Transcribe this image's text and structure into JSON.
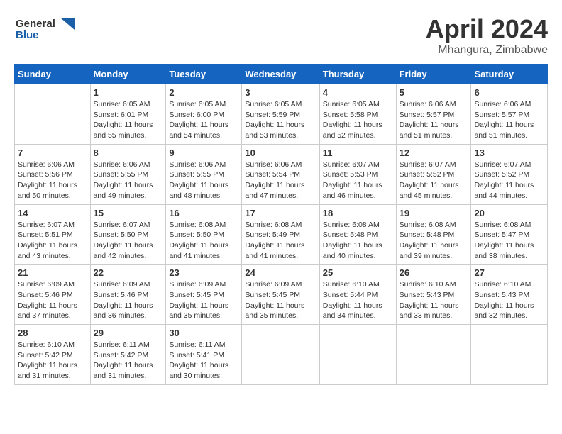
{
  "header": {
    "logo_general": "General",
    "logo_blue": "Blue",
    "title": "April 2024",
    "subtitle": "Mhangura, Zimbabwe"
  },
  "columns": [
    "Sunday",
    "Monday",
    "Tuesday",
    "Wednesday",
    "Thursday",
    "Friday",
    "Saturday"
  ],
  "weeks": [
    [
      {
        "day": "",
        "info": ""
      },
      {
        "day": "1",
        "info": "Sunrise: 6:05 AM\nSunset: 6:01 PM\nDaylight: 11 hours and 55 minutes."
      },
      {
        "day": "2",
        "info": "Sunrise: 6:05 AM\nSunset: 6:00 PM\nDaylight: 11 hours and 54 minutes."
      },
      {
        "day": "3",
        "info": "Sunrise: 6:05 AM\nSunset: 5:59 PM\nDaylight: 11 hours and 53 minutes."
      },
      {
        "day": "4",
        "info": "Sunrise: 6:05 AM\nSunset: 5:58 PM\nDaylight: 11 hours and 52 minutes."
      },
      {
        "day": "5",
        "info": "Sunrise: 6:06 AM\nSunset: 5:57 PM\nDaylight: 11 hours and 51 minutes."
      },
      {
        "day": "6",
        "info": "Sunrise: 6:06 AM\nSunset: 5:57 PM\nDaylight: 11 hours and 51 minutes."
      }
    ],
    [
      {
        "day": "7",
        "info": "Sunrise: 6:06 AM\nSunset: 5:56 PM\nDaylight: 11 hours and 50 minutes."
      },
      {
        "day": "8",
        "info": "Sunrise: 6:06 AM\nSunset: 5:55 PM\nDaylight: 11 hours and 49 minutes."
      },
      {
        "day": "9",
        "info": "Sunrise: 6:06 AM\nSunset: 5:55 PM\nDaylight: 11 hours and 48 minutes."
      },
      {
        "day": "10",
        "info": "Sunrise: 6:06 AM\nSunset: 5:54 PM\nDaylight: 11 hours and 47 minutes."
      },
      {
        "day": "11",
        "info": "Sunrise: 6:07 AM\nSunset: 5:53 PM\nDaylight: 11 hours and 46 minutes."
      },
      {
        "day": "12",
        "info": "Sunrise: 6:07 AM\nSunset: 5:52 PM\nDaylight: 11 hours and 45 minutes."
      },
      {
        "day": "13",
        "info": "Sunrise: 6:07 AM\nSunset: 5:52 PM\nDaylight: 11 hours and 44 minutes."
      }
    ],
    [
      {
        "day": "14",
        "info": "Sunrise: 6:07 AM\nSunset: 5:51 PM\nDaylight: 11 hours and 43 minutes."
      },
      {
        "day": "15",
        "info": "Sunrise: 6:07 AM\nSunset: 5:50 PM\nDaylight: 11 hours and 42 minutes."
      },
      {
        "day": "16",
        "info": "Sunrise: 6:08 AM\nSunset: 5:50 PM\nDaylight: 11 hours and 41 minutes."
      },
      {
        "day": "17",
        "info": "Sunrise: 6:08 AM\nSunset: 5:49 PM\nDaylight: 11 hours and 41 minutes."
      },
      {
        "day": "18",
        "info": "Sunrise: 6:08 AM\nSunset: 5:48 PM\nDaylight: 11 hours and 40 minutes."
      },
      {
        "day": "19",
        "info": "Sunrise: 6:08 AM\nSunset: 5:48 PM\nDaylight: 11 hours and 39 minutes."
      },
      {
        "day": "20",
        "info": "Sunrise: 6:08 AM\nSunset: 5:47 PM\nDaylight: 11 hours and 38 minutes."
      }
    ],
    [
      {
        "day": "21",
        "info": "Sunrise: 6:09 AM\nSunset: 5:46 PM\nDaylight: 11 hours and 37 minutes."
      },
      {
        "day": "22",
        "info": "Sunrise: 6:09 AM\nSunset: 5:46 PM\nDaylight: 11 hours and 36 minutes."
      },
      {
        "day": "23",
        "info": "Sunrise: 6:09 AM\nSunset: 5:45 PM\nDaylight: 11 hours and 35 minutes."
      },
      {
        "day": "24",
        "info": "Sunrise: 6:09 AM\nSunset: 5:45 PM\nDaylight: 11 hours and 35 minutes."
      },
      {
        "day": "25",
        "info": "Sunrise: 6:10 AM\nSunset: 5:44 PM\nDaylight: 11 hours and 34 minutes."
      },
      {
        "day": "26",
        "info": "Sunrise: 6:10 AM\nSunset: 5:43 PM\nDaylight: 11 hours and 33 minutes."
      },
      {
        "day": "27",
        "info": "Sunrise: 6:10 AM\nSunset: 5:43 PM\nDaylight: 11 hours and 32 minutes."
      }
    ],
    [
      {
        "day": "28",
        "info": "Sunrise: 6:10 AM\nSunset: 5:42 PM\nDaylight: 11 hours and 31 minutes."
      },
      {
        "day": "29",
        "info": "Sunrise: 6:11 AM\nSunset: 5:42 PM\nDaylight: 11 hours and 31 minutes."
      },
      {
        "day": "30",
        "info": "Sunrise: 6:11 AM\nSunset: 5:41 PM\nDaylight: 11 hours and 30 minutes."
      },
      {
        "day": "",
        "info": ""
      },
      {
        "day": "",
        "info": ""
      },
      {
        "day": "",
        "info": ""
      },
      {
        "day": "",
        "info": ""
      }
    ]
  ]
}
